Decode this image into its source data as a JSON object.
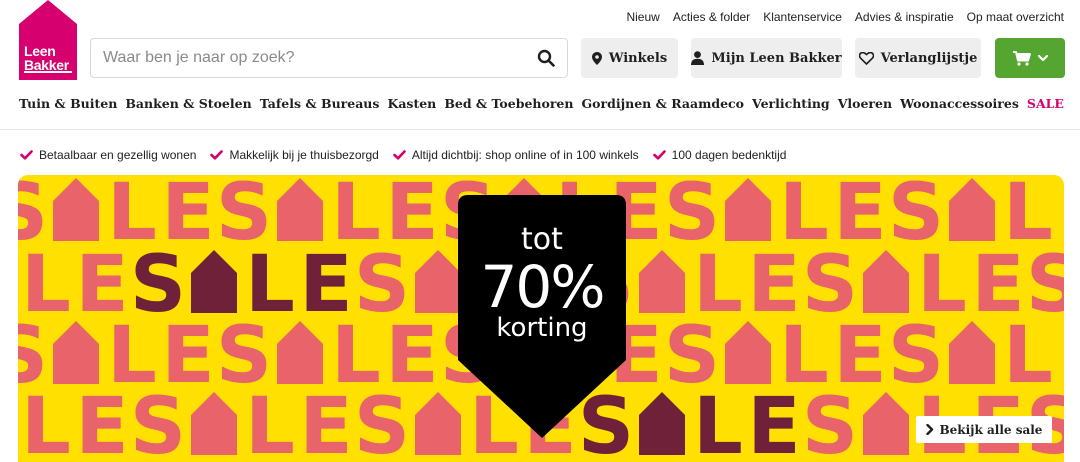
{
  "toplinks": [
    "Nieuw",
    "Acties & folder",
    "Klantenservice",
    "Advies & inspiratie",
    "Op maat overzicht"
  ],
  "logo": {
    "line1": "Leen",
    "line2": "Bakker",
    "color": "#d6006e"
  },
  "search": {
    "placeholder": "Waar ben je naar op zoek?",
    "value": ""
  },
  "header": {
    "winkels": "Winkels",
    "account": "Mijn Leen Bakker",
    "wishlist": "Verlanglijstje",
    "cart_color": "#55a630"
  },
  "nav": [
    "Tuin & Buiten",
    "Banken & Stoelen",
    "Tafels & Bureaus",
    "Kasten",
    "Bed & Toebehoren",
    "Gordijnen & Raamdeco",
    "Verlichting",
    "Vloeren",
    "Woonaccessoires",
    "SALE"
  ],
  "usps": [
    "Betaalbaar en gezellig wonen",
    "Makkelijk bij je thuisbezorgd",
    "Altijd dichtbij: shop online of in 100 winkels",
    "100 dagen bedenktijd"
  ],
  "banner": {
    "pattern_word": "SALE",
    "tag_line1": "tot",
    "tag_line2": "70%",
    "tag_line3": "korting",
    "cta": "Bekijk alle sale",
    "colors": {
      "background": "#ffe000",
      "letters": "#e8636a",
      "letters_dark": "#6e2138",
      "tag": "#000000"
    }
  },
  "icons": [
    "search-icon",
    "map-pin-icon",
    "user-icon",
    "heart-icon",
    "cart-icon",
    "chevron-down-icon",
    "checkmark-icon",
    "chevron-right-icon"
  ]
}
